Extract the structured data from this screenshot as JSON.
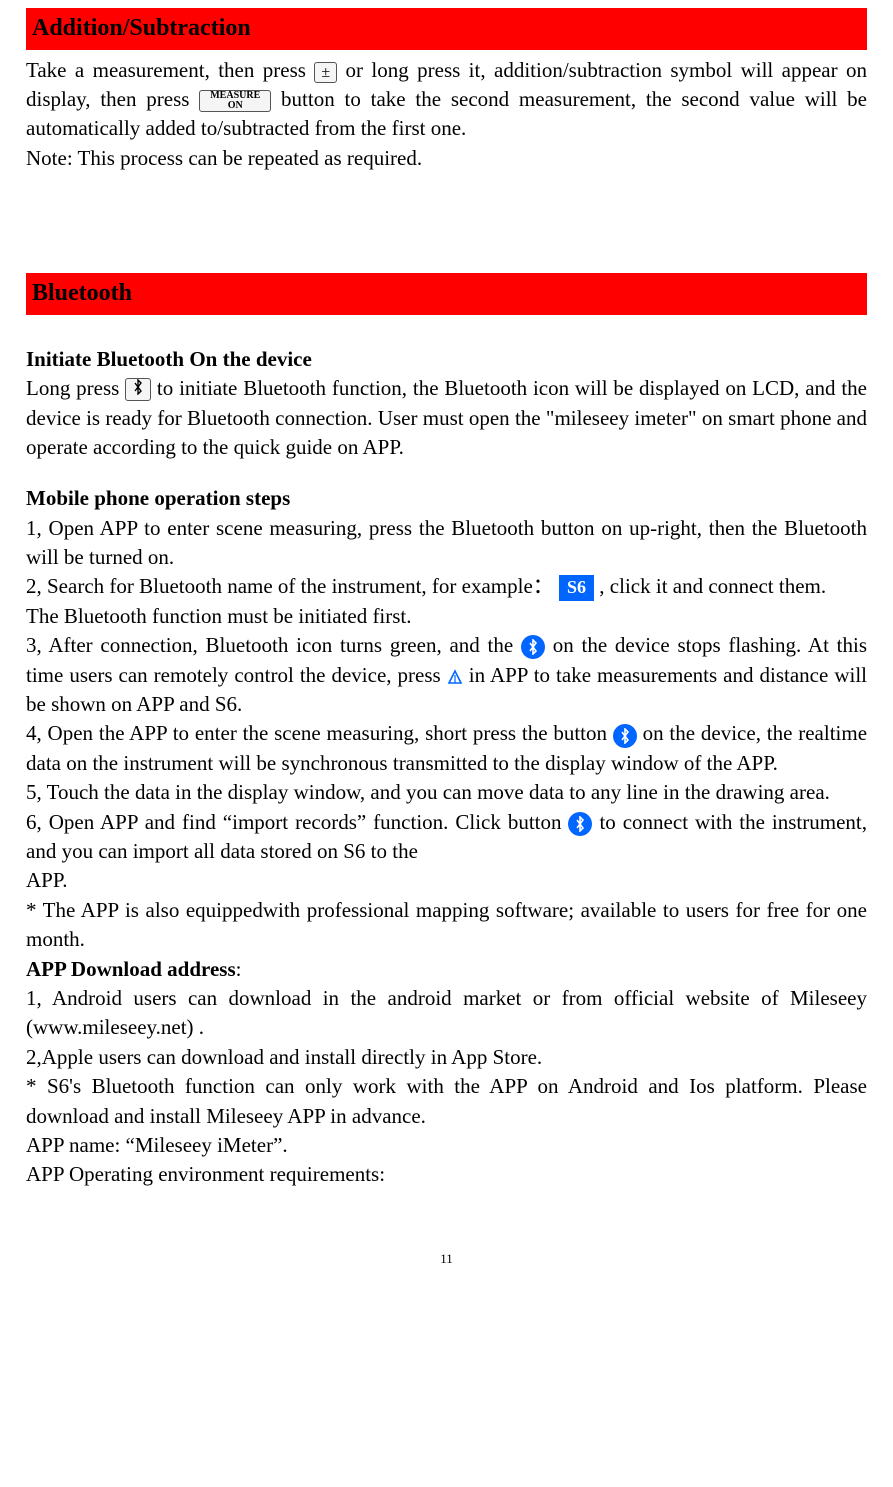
{
  "sections": {
    "addsub": {
      "title": "Addition/Subtraction",
      "line1_a": "Take a measurement, then press ",
      "line1_b": "or long press it, addition/subtraction symbol will appear on display, then press",
      "line1_c": "button to take the second measurement, the second value will be automatically added to/subtracted from the first one.",
      "note": "Note: This process can be repeated as required."
    },
    "bluetooth": {
      "title": "Bluetooth",
      "init_heading": "Initiate Bluetooth On the device",
      "init_a": "Long press ",
      "init_b": " to initiate Bluetooth function, the Bluetooth icon will be displayed on LCD, and the device is ready for Bluetooth connection. User must open the \"mileseey imeter\" on smart phone and operate according to the quick guide on APP.",
      "mobile_heading": "Mobile phone operation steps",
      "step1": "1, Open APP to enter scene measuring, press the Bluetooth button on up-right, then the Bluetooth will be turned on.",
      "step2_a": "2, Search for Bluetooth name of the instrument, for example：",
      "step2_b": ", click it and connect them.",
      "step2_note": "The Bluetooth function must be initiated first.",
      "step3_a": "3, After connection, Bluetooth icon turns green, and the",
      "step3_b": "on the device stops flashing. At this time users can remotely control the device, press ",
      "step3_c": " in APP to take measurements and distance will be shown on APP and S6.",
      "step4_a": "4, Open the APP to enter the scene measuring, short press the button",
      "step4_b": " on the device, the realtime data on the instrument will be synchronous transmitted to the display window of the APP.",
      "step5": "5, Touch the data in the display window, and you can move data to any line in the drawing area.",
      "step6_a": "6, Open APP and find “import records” function. Click button ",
      "step6_b": "to connect with the instrument, and you can import all data stored on S6 to the",
      "step6_app": "APP.",
      "note_mapping": "* The APP is also equippedwith professional mapping software; available to users for free for one month.",
      "download_heading": "APP Download address",
      "download_colon": ":",
      "dl1": "1, Android users can download in the android market or from official website of Mileseey (www.mileseey.net) .",
      "dl2": "2,Apple users can download and install directly in App Store.",
      "note_platform": "* S6's Bluetooth function can only work with the APP on Android and Ios platform. Please download and install Mileseey APP in advance.",
      "app_name": "APP name: “Mileseey iMeter”.",
      "env_req": "APP Operating environment requirements:"
    }
  },
  "icons": {
    "plusminus": "±",
    "measure_top": "MEASURE",
    "measure_bottom": "ON",
    "bt_glyph": "⁕",
    "s6": "S6"
  },
  "page_number": "11"
}
